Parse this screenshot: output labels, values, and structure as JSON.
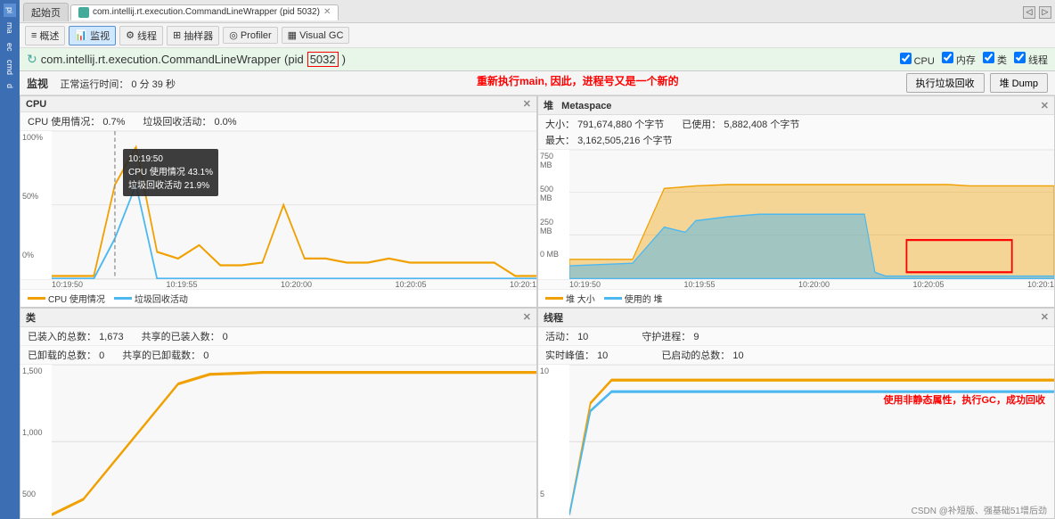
{
  "tabs": [
    {
      "label": "起始页",
      "active": false,
      "hasClose": false
    },
    {
      "label": "com.intellij.rt.execution.CommandLineWrapper (pid 5032)",
      "active": true,
      "hasClose": true
    }
  ],
  "toolbar": {
    "items": [
      {
        "label": "概述",
        "icon": "list"
      },
      {
        "label": "监视",
        "icon": "monitor"
      },
      {
        "label": "线程",
        "icon": "thread"
      },
      {
        "label": "抽样器",
        "icon": "sample"
      },
      {
        "label": "Profiler",
        "icon": "profiler"
      },
      {
        "label": "Visual GC",
        "icon": "gc"
      }
    ]
  },
  "header": {
    "title": "com.intellij.rt.execution.CommandLineWrapper",
    "pid": "5032",
    "section": "监视"
  },
  "checkboxes": {
    "cpu": {
      "label": "CPU",
      "checked": true
    },
    "memory": {
      "label": "内存",
      "checked": true
    },
    "classes": {
      "label": "类",
      "checked": true
    },
    "threads": {
      "label": "线程",
      "checked": true
    }
  },
  "monitor": {
    "uptime_label": "正常运行时间：",
    "uptime_value": "0 分 39 秒",
    "gc_button": "执行垃圾回收",
    "dump_button": "堆 Dump"
  },
  "annotations": {
    "top": "重新执行main, 因此，进程号又是一个新的",
    "bottom": "使用非静态属性，执行GC，成功回收"
  },
  "cpu_panel": {
    "title": "CPU",
    "usage_label": "CPU 使用情况：",
    "usage_value": "0.7%",
    "gc_label": "垃圾回收活动：",
    "gc_value": "0.0%",
    "tooltip": {
      "time": "10:19:50",
      "cpu_label": "CPU 使用情况",
      "cpu_value": "43.1%",
      "gc_label": "垃圾回收活动",
      "gc_value": "21.9%"
    },
    "legend": [
      {
        "label": "CPU 使用情况",
        "color": "#f0a000"
      },
      {
        "label": "垃圾回收活动",
        "color": "#4db8f0"
      }
    ],
    "y_labels": [
      "100%",
      "50%",
      "0%"
    ],
    "x_labels": [
      "10:19:50",
      "10:19:55",
      "10:20:00",
      "10:20:05",
      "10:20:1"
    ]
  },
  "heap_panel": {
    "title": "堆",
    "subtitle": "Metaspace",
    "size_label": "大小：",
    "size_value": "791,674,880 个字节",
    "max_label": "最大：",
    "max_value": "3,162,505,216 个字节",
    "used_label": "已使用：",
    "used_value": "5,882,408 个字节",
    "legend": [
      {
        "label": "堆 大小",
        "color": "#f0a000"
      },
      {
        "label": "使用的 堆",
        "color": "#4db8f0"
      }
    ],
    "y_labels": [
      "750 MB",
      "500 MB",
      "250 MB",
      "0 MB"
    ],
    "x_labels": [
      "10:19:50",
      "10:19:55",
      "10:20:00",
      "10:20:05",
      "10:20:1"
    ]
  },
  "classes_panel": {
    "title": "类",
    "loaded_label": "已装入的总数：",
    "loaded_value": "1,673",
    "shared_loaded_label": "共享的已装入数：",
    "shared_loaded_value": "0",
    "unloaded_label": "已卸载的总数：",
    "unloaded_value": "0",
    "shared_unloaded_label": "共享的已卸载数：",
    "shared_unloaded_value": "0",
    "y_labels": [
      "1,500",
      "1,000",
      "500"
    ]
  },
  "threads_panel": {
    "title": "线程",
    "active_label": "活动：",
    "active_value": "10",
    "peak_label": "实时峰值：",
    "peak_value": "10",
    "daemon_label": "守护进程：",
    "daemon_value": "9",
    "total_label": "已启动的总数：",
    "total_value": "10",
    "y_labels": [
      "10",
      "5"
    ]
  },
  "watermark": "CSDN @补短版、强基础51增后劲"
}
